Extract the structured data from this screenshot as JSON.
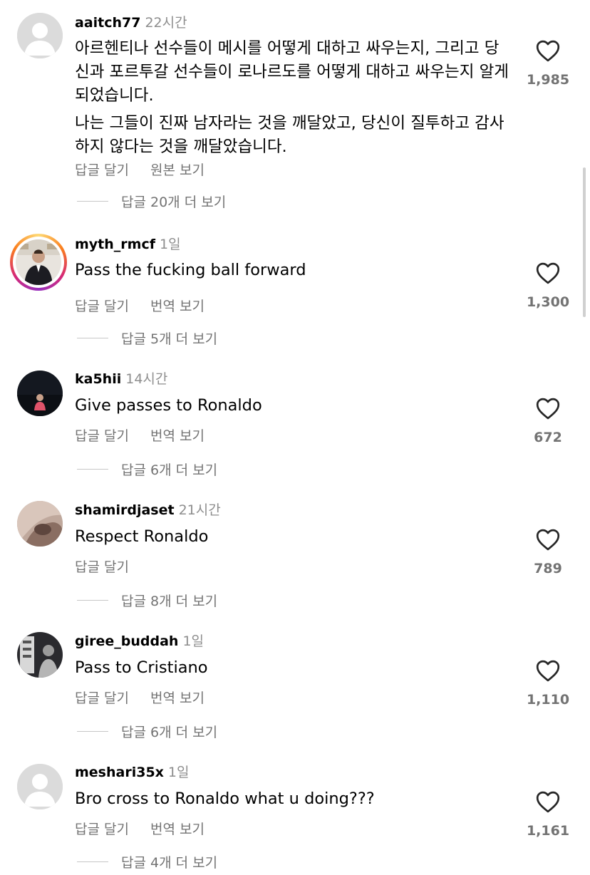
{
  "labels": {
    "reply": "답글 달기",
    "see_original": "원본 보기",
    "see_translation": "번역 보기"
  },
  "icons": {
    "heart": "heart-outline-icon",
    "default_avatar": "default-avatar-icon"
  },
  "colors": {
    "secondary_text": "#737373",
    "time_text": "#8e8e8e",
    "story_ring": [
      "#feda75",
      "#fa7e1e",
      "#d62976",
      "#962fbf"
    ]
  },
  "comments": [
    {
      "username": "aaitch77",
      "time": "22시간",
      "text": [
        "아르헨티나 선수들이 메시를 어떻게 대하고 싸우는지, 그리고 당신과 포르투갈 선수들이 로나르도를 어떻게 대하고 싸우는지 알게 되었습니다.",
        "나는 그들이 진짜 남자라는 것을 깨달았고, 당신이 질투하고 감사하지 않다는 것을 깨달았습니다."
      ],
      "secondary_action": "원본 보기",
      "likes": "1,985",
      "view_replies": "답글 20개 더 보기"
    },
    {
      "username": "myth_rmcf",
      "time": "1일",
      "text": [
        "Pass the fucking ball forward"
      ],
      "secondary_action": "번역 보기",
      "likes": "1,300",
      "view_replies": "답글 5개 더 보기"
    },
    {
      "username": "ka5hii",
      "time": "14시간",
      "text": [
        "Give passes to Ronaldo"
      ],
      "secondary_action": "번역 보기",
      "likes": "672",
      "view_replies": "답글 6개 더 보기"
    },
    {
      "username": "shamirdjaset",
      "time": "21시간",
      "text": [
        "Respect Ronaldo"
      ],
      "secondary_action": "",
      "likes": "789",
      "view_replies": "답글 8개 더 보기"
    },
    {
      "username": "giree_buddah",
      "time": "1일",
      "text": [
        "Pass to Cristiano"
      ],
      "secondary_action": "번역 보기",
      "likes": "1,110",
      "view_replies": "답글 6개 더 보기"
    },
    {
      "username": "meshari35x",
      "time": "1일",
      "text": [
        "Bro cross to Ronaldo what u doing???"
      ],
      "secondary_action": "번역 보기",
      "likes": "1,161",
      "view_replies": "답글 4개 더 보기"
    }
  ]
}
